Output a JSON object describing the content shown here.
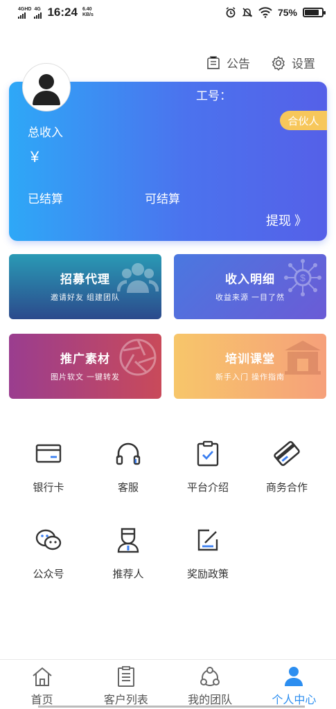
{
  "status_bar": {
    "network1": "4GHD",
    "network2": "4G",
    "time": "16:24",
    "speed_value": "6.40",
    "speed_unit": "KB/s",
    "battery": "75%"
  },
  "top_links": {
    "announcement": "公告",
    "settings": "设置"
  },
  "profile_card": {
    "job_number_label": "工号：",
    "badge": "合伙人",
    "total_income_label": "总收入",
    "currency": "¥",
    "settled_label": "已结算",
    "settleable_label": "可结算",
    "withdraw": "提现 》"
  },
  "tiles": [
    {
      "title": "招募代理",
      "subtitle": "邀请好友  组建团队",
      "icon": "team-icon",
      "color_start": "#2a9ab5",
      "color_end": "#2b4a8c"
    },
    {
      "title": "收入明细",
      "subtitle": "收益来源  一目了然",
      "icon": "income-network-icon",
      "color_start": "#4a78e0",
      "color_end": "#6b5bd6"
    },
    {
      "title": "推广素材",
      "subtitle": "图片软文  一键转发",
      "icon": "aperture-icon",
      "color_start": "#9a3d8f",
      "color_end": "#c94a5a"
    },
    {
      "title": "培训课堂",
      "subtitle": "新手入门  操作指南",
      "icon": "building-icon",
      "color_start": "#f7c66a",
      "color_end": "#f6a07a"
    }
  ],
  "grid": [
    {
      "label": "银行卡",
      "icon": "bank-card-icon"
    },
    {
      "label": "客服",
      "icon": "headset-icon"
    },
    {
      "label": "平台介绍",
      "icon": "clipboard-check-icon"
    },
    {
      "label": "商务合作",
      "icon": "handshake-icon"
    },
    {
      "label": "公众号",
      "icon": "wechat-icon"
    },
    {
      "label": "推荐人",
      "icon": "referrer-icon"
    },
    {
      "label": "奖励政策",
      "icon": "edit-policy-icon"
    }
  ],
  "bottom_nav": [
    {
      "label": "首页",
      "icon": "home-icon"
    },
    {
      "label": "客户列表",
      "icon": "list-icon"
    },
    {
      "label": "我的团队",
      "icon": "team-nodes-icon"
    },
    {
      "label": "个人中心",
      "icon": "user-icon"
    }
  ],
  "colors": {
    "accent": "#2c8ef0",
    "badge": "#f7c75b"
  }
}
